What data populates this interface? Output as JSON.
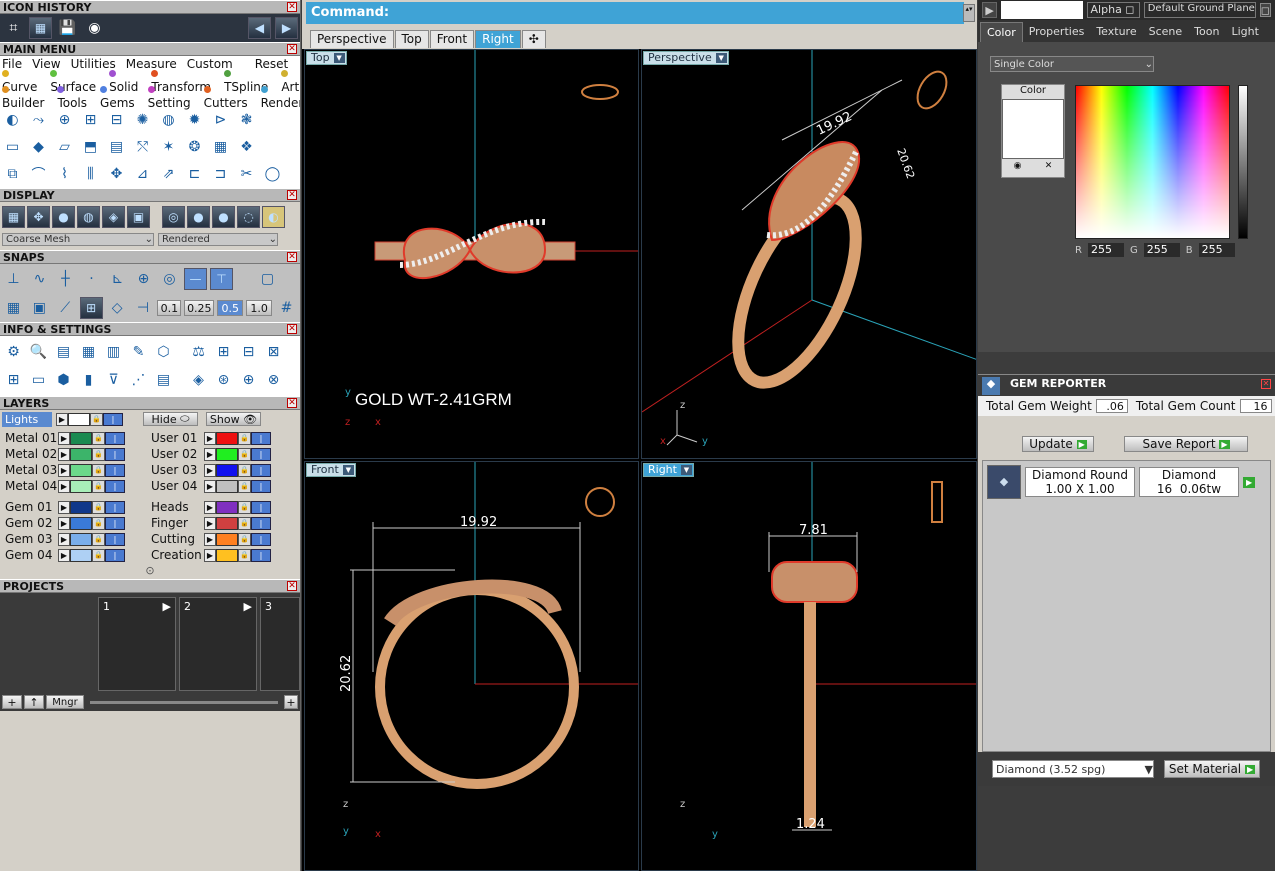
{
  "icon_history": {
    "title": "ICON HISTORY"
  },
  "main_menu": {
    "title": "MAIN MENU",
    "items": [
      "File",
      "View",
      "Utilities",
      "Measure",
      "Custom"
    ],
    "reset": "Reset",
    "row2": [
      {
        "label": "Curve",
        "color": "#e0b020"
      },
      {
        "label": "Surface",
        "color": "#60c040"
      },
      {
        "label": "Solid",
        "color": "#a050d0"
      },
      {
        "label": "Transform",
        "color": "#e05020"
      },
      {
        "label": "TSpline",
        "color": "#50a040"
      },
      {
        "label": "Art",
        "color": "#d0b030"
      }
    ],
    "row3": [
      {
        "label": "Builder",
        "color": "#e09020"
      },
      {
        "label": "Tools",
        "color": "#8060e0"
      },
      {
        "label": "Gems",
        "color": "#5080e0"
      },
      {
        "label": "Setting",
        "color": "#c040c0"
      },
      {
        "label": "Cutters",
        "color": "#e06020"
      },
      {
        "label": "Render",
        "color": "#40a0d0"
      }
    ]
  },
  "display": {
    "title": "DISPLAY",
    "mesh": "Coarse Mesh",
    "render": "Rendered"
  },
  "snaps": {
    "title": "SNAPS",
    "values": [
      "0.1",
      "0.25",
      "0.5",
      "1.0"
    ]
  },
  "info": {
    "title": "INFO & SETTINGS"
  },
  "layers": {
    "title": "LAYERS",
    "lights": "Lights",
    "hide": "Hide",
    "show": "Show",
    "left": [
      {
        "name": "Metal 01",
        "color": "#1a8a50"
      },
      {
        "name": "Metal 02",
        "color": "#3cb46a"
      },
      {
        "name": "Metal 03",
        "color": "#6cd88a"
      },
      {
        "name": "Metal 04",
        "color": "#a8eeb8"
      },
      {
        "name": "Gem 01",
        "color": "#10388a"
      },
      {
        "name": "Gem 02",
        "color": "#3a7ad8"
      },
      {
        "name": "Gem 03",
        "color": "#7aaeea"
      },
      {
        "name": "Gem 04",
        "color": "#aed0f4"
      }
    ],
    "right": [
      {
        "name": "User 01",
        "color": "#ee1010"
      },
      {
        "name": "User 02",
        "color": "#20ee20"
      },
      {
        "name": "User 03",
        "color": "#1010ee"
      },
      {
        "name": "User 04",
        "color": "#c0c0c0"
      },
      {
        "name": "Heads",
        "color": "#8030c0"
      },
      {
        "name": "Finger",
        "color": "#d04040"
      },
      {
        "name": "Cutting",
        "color": "#ff8020"
      },
      {
        "name": "Creation",
        "color": "#ffc020"
      }
    ]
  },
  "projects": {
    "title": "PROJECTS",
    "slots": [
      "1",
      "2",
      "3"
    ],
    "mngr": "Mngr"
  },
  "command": {
    "label": "Command:"
  },
  "tabs": [
    "Perspective",
    "Top",
    "Front",
    "Right"
  ],
  "viewports": {
    "top": "Top",
    "perspective": "Perspective",
    "front": "Front",
    "right": "Right",
    "gold_weight": "GOLD WT-2.41GRM",
    "dims": {
      "persp_a": "19.92",
      "persp_b": "20.62",
      "front_w": "19.92",
      "front_h": "20.62",
      "right_w": "7.81",
      "right_b": "1.24"
    }
  },
  "right_panel": {
    "alpha": "Alpha",
    "ground": "Default Ground Plane",
    "tabs": [
      "Color",
      "Properties",
      "Texture",
      "Scene",
      "Toon",
      "Light"
    ],
    "color_mode": "Single Color",
    "color_label": "Color",
    "r": "255",
    "g": "255",
    "b": "255"
  },
  "gem_reporter": {
    "title": "GEM REPORTER",
    "weight_label": "Total Gem Weight",
    "weight": ".06",
    "count_label": "Total Gem Count",
    "count": "16",
    "update": "Update",
    "save": "Save Report",
    "gem": {
      "name": "Diamond Round",
      "size": "1.00 X 1.00",
      "material": "Diamond",
      "count": "16",
      "weight": "0.06tw"
    },
    "material_select": "Diamond    (3.52 spg)",
    "set_material": "Set Material"
  }
}
